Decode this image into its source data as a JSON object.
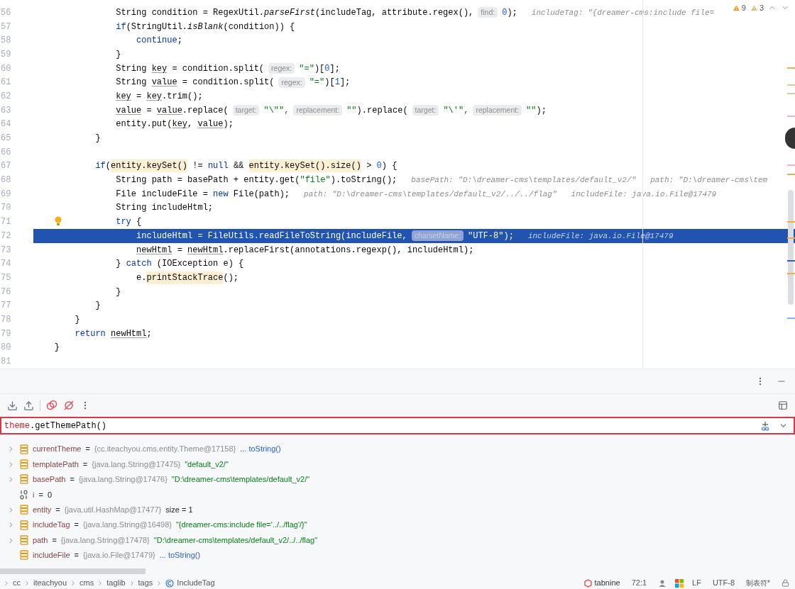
{
  "editor": {
    "inspections": [
      {
        "kind": "warning",
        "count": "9"
      },
      {
        "kind": "weak_warning",
        "count": "3"
      }
    ],
    "lines": [
      {
        "number": "56",
        "current": false,
        "bulb": false,
        "tokens": [
          {
            "kind": "plain",
            "text": "                String condition = RegexUtil."
          },
          {
            "kind": "italic",
            "text": "parseFirst"
          },
          {
            "kind": "plain",
            "text": "(includeTag, attribute.regex(),"
          },
          {
            "kind": "hint",
            "text": "find:"
          },
          {
            "kind": "number",
            "text": "0"
          },
          {
            "kind": "plain",
            "text": ");"
          },
          {
            "kind": "value",
            "text": "includeTag: \"{dreamer-cms:include file="
          }
        ]
      },
      {
        "number": "57",
        "current": false,
        "bulb": false,
        "tokens": [
          {
            "kind": "keyword",
            "text": "                if"
          },
          {
            "kind": "plain",
            "text": "(StringUtil."
          },
          {
            "kind": "italic",
            "text": "isBlank"
          },
          {
            "kind": "plain",
            "text": "(condition)) {"
          }
        ]
      },
      {
        "number": "58",
        "current": false,
        "bulb": false,
        "tokens": [
          {
            "kind": "keyword",
            "text": "                    continue"
          },
          {
            "kind": "plain",
            "text": ";"
          }
        ]
      },
      {
        "number": "59",
        "current": false,
        "bulb": false,
        "tokens": [
          {
            "kind": "plain",
            "text": "                }"
          }
        ]
      },
      {
        "number": "60",
        "current": false,
        "bulb": false,
        "tokens": [
          {
            "kind": "plain",
            "text": "                String "
          },
          {
            "kind": "var",
            "text": "key"
          },
          {
            "kind": "plain",
            "text": " = condition.split("
          },
          {
            "kind": "hint",
            "text": "regex:"
          },
          {
            "kind": "string",
            "text": "\"=\""
          },
          {
            "kind": "plain",
            "text": ")["
          },
          {
            "kind": "number",
            "text": "0"
          },
          {
            "kind": "plain",
            "text": "];"
          }
        ]
      },
      {
        "number": "61",
        "current": false,
        "bulb": false,
        "tokens": [
          {
            "kind": "plain",
            "text": "                String "
          },
          {
            "kind": "var",
            "text": "value"
          },
          {
            "kind": "plain",
            "text": " = condition.split("
          },
          {
            "kind": "hint",
            "text": "regex:"
          },
          {
            "kind": "string",
            "text": "\"=\""
          },
          {
            "kind": "plain",
            "text": ")["
          },
          {
            "kind": "number",
            "text": "1"
          },
          {
            "kind": "plain",
            "text": "];"
          }
        ]
      },
      {
        "number": "62",
        "current": false,
        "bulb": false,
        "tokens": [
          {
            "kind": "var",
            "text": "                key"
          },
          {
            "kind": "plain",
            "text": " = "
          },
          {
            "kind": "var",
            "text": "key"
          },
          {
            "kind": "plain",
            "text": ".trim();"
          }
        ]
      },
      {
        "number": "63",
        "current": false,
        "bulb": false,
        "tokens": [
          {
            "kind": "var",
            "text": "                value"
          },
          {
            "kind": "plain",
            "text": " = "
          },
          {
            "kind": "var",
            "text": "value"
          },
          {
            "kind": "plain",
            "text": ".replace("
          },
          {
            "kind": "hint",
            "text": "target:"
          },
          {
            "kind": "string",
            "text": "\"\\\"\","
          },
          {
            "kind": "hint",
            "text": "replacement:"
          },
          {
            "kind": "string",
            "text": "\"\""
          },
          {
            "kind": "plain",
            "text": ").replace("
          },
          {
            "kind": "hint",
            "text": "target:"
          },
          {
            "kind": "string",
            "text": "\"\\'\","
          },
          {
            "kind": "hint",
            "text": "replacement:"
          },
          {
            "kind": "string",
            "text": "\"\""
          },
          {
            "kind": "plain",
            "text": ");"
          }
        ]
      },
      {
        "number": "64",
        "current": false,
        "bulb": false,
        "tokens": [
          {
            "kind": "plain",
            "text": "                entity.put("
          },
          {
            "kind": "var",
            "text": "key"
          },
          {
            "kind": "plain",
            "text": ", "
          },
          {
            "kind": "var",
            "text": "value"
          },
          {
            "kind": "plain",
            "text": ");"
          }
        ]
      },
      {
        "number": "65",
        "current": false,
        "bulb": false,
        "tokens": [
          {
            "kind": "plain",
            "text": "            }"
          }
        ]
      },
      {
        "number": "66",
        "current": false,
        "bulb": false
      },
      {
        "number": "67",
        "current": false,
        "bulb": false,
        "tokens": [
          {
            "kind": "keyword",
            "text": "            if"
          },
          {
            "kind": "plain",
            "text": "("
          },
          {
            "kind": "usage",
            "text": "entity.keySet()"
          },
          {
            "kind": "plain",
            "text": " != "
          },
          {
            "kind": "keyword",
            "text": "null"
          },
          {
            "kind": "plain",
            "text": " && "
          },
          {
            "kind": "usage",
            "text": "entity.keySet().size()"
          },
          {
            "kind": "plain",
            "text": " > "
          },
          {
            "kind": "number",
            "text": "0"
          },
          {
            "kind": "plain",
            "text": ") {"
          }
        ]
      },
      {
        "number": "68",
        "current": false,
        "bulb": false,
        "tokens": [
          {
            "kind": "plain",
            "text": "                String path = basePath + entity.get("
          },
          {
            "kind": "string",
            "text": "\"file\""
          },
          {
            "kind": "plain",
            "text": ").toString();"
          },
          {
            "kind": "value",
            "text": "basePath: \"D:\\dreamer-cms\\templates/default_v2/\""
          },
          {
            "kind": "value",
            "text": "path: \"D:\\dreamer-cms\\tem"
          }
        ]
      },
      {
        "number": "69",
        "current": false,
        "bulb": false,
        "tokens": [
          {
            "kind": "plain",
            "text": "                File includeFile = "
          },
          {
            "kind": "keyword",
            "text": "new"
          },
          {
            "kind": "plain",
            "text": " File(path);"
          },
          {
            "kind": "value",
            "text": "path: \"D:\\dreamer-cms\\templates/default_v2/../../flag\""
          },
          {
            "kind": "value",
            "text": "includeFile: java.io.File@17479"
          }
        ]
      },
      {
        "number": "70",
        "current": false,
        "bulb": false,
        "tokens": [
          {
            "kind": "plain",
            "text": "                String includeHtml;"
          }
        ]
      },
      {
        "number": "71",
        "current": false,
        "bulb": true,
        "tokens": [
          {
            "kind": "keyword",
            "text": "                try"
          },
          {
            "kind": "plain",
            "text": " {"
          }
        ]
      },
      {
        "number": "72",
        "current": true,
        "bulb": false,
        "tokens": [
          {
            "kind": "plain",
            "text": "                    includeHtml = FileUtils."
          },
          {
            "kind": "italic",
            "text": "readFileToString"
          },
          {
            "kind": "plain",
            "text": "(includeFile,"
          },
          {
            "kind": "hint",
            "text": "charsetName:"
          },
          {
            "kind": "string",
            "text": "\"UTF-8\""
          },
          {
            "kind": "plain",
            "text": ");"
          },
          {
            "kind": "value",
            "text": "includeFile: java.io.File@17479"
          }
        ]
      },
      {
        "number": "73",
        "current": false,
        "bulb": false,
        "tokens": [
          {
            "kind": "var",
            "text": "                    newHtml"
          },
          {
            "kind": "plain",
            "text": " = "
          },
          {
            "kind": "var",
            "text": "newHtml"
          },
          {
            "kind": "plain",
            "text": ".replaceFirst(annotations.regexp(), includeHtml);"
          }
        ]
      },
      {
        "number": "74",
        "current": false,
        "bulb": false,
        "tokens": [
          {
            "kind": "plain",
            "text": "                } "
          },
          {
            "kind": "keyword",
            "text": "catch"
          },
          {
            "kind": "plain",
            "text": " (IOException e) {"
          }
        ]
      },
      {
        "number": "75",
        "current": false,
        "bulb": false,
        "tokens": [
          {
            "kind": "plain",
            "text": "                    e."
          },
          {
            "kind": "usage",
            "text": "printStackTrace"
          },
          {
            "kind": "plain",
            "text": "();"
          }
        ]
      },
      {
        "number": "76",
        "current": false,
        "bulb": false,
        "tokens": [
          {
            "kind": "plain",
            "text": "                }"
          }
        ]
      },
      {
        "number": "77",
        "current": false,
        "bulb": false,
        "tokens": [
          {
            "kind": "plain",
            "text": "            }"
          }
        ]
      },
      {
        "number": "78",
        "current": false,
        "bulb": false,
        "tokens": [
          {
            "kind": "plain",
            "text": "        }"
          }
        ]
      },
      {
        "number": "79",
        "current": false,
        "bulb": false,
        "tokens": [
          {
            "kind": "keyword",
            "text": "        return "
          },
          {
            "kind": "var",
            "text": "newHtml"
          },
          {
            "kind": "plain",
            "text": ";"
          }
        ]
      },
      {
        "number": "80",
        "current": false,
        "bulb": false,
        "tokens": [
          {
            "kind": "plain",
            "text": "    }"
          }
        ]
      },
      {
        "number": "81",
        "current": false,
        "bulb": false
      }
    ]
  },
  "debugger": {
    "expression": [
      {
        "kind": "var",
        "text": "theme"
      },
      {
        "kind": "plain",
        "text": ".getThemePath()"
      }
    ],
    "variables": [
      {
        "kind": "object",
        "expandable": true,
        "name": "currentTheme",
        "operator": "=",
        "type": "{cc.iteachyou.cms.entity.Theme@17158}",
        "link_value": "... toString()"
      },
      {
        "kind": "object",
        "expandable": true,
        "name": "templatePath",
        "operator": "=",
        "type": "{java.lang.String@17475}",
        "string_value": "\"default_v2/\""
      },
      {
        "kind": "object",
        "expandable": true,
        "name": "basePath",
        "operator": "=",
        "type": "{java.lang.String@17476}",
        "string_value": "\"D:\\dreamer-cms\\templates/default_v2/\""
      },
      {
        "kind": "primitive",
        "expandable": false,
        "name": "i",
        "operator": "=",
        "plain_value": "0"
      },
      {
        "kind": "object",
        "expandable": true,
        "name": "entity",
        "operator": "=",
        "type": "{java.util.HashMap@17477}",
        "plain_value": "size = 1"
      },
      {
        "kind": "object",
        "expandable": true,
        "name": "includeTag",
        "operator": "=",
        "type": "{java.lang.String@16498}",
        "string_value": "\"{dreamer-cms:include file='../../flag'/}\""
      },
      {
        "kind": "object",
        "expandable": true,
        "name": "path",
        "operator": "=",
        "type": "{java.lang.String@17478}",
        "string_value": "\"D:\\dreamer-cms\\templates/default_v2/../../flag\""
      },
      {
        "kind": "object",
        "expandable": false,
        "name": "includeFile",
        "operator": "=",
        "type": "{java.io.File@17479}",
        "link_value": "... toString()"
      }
    ]
  },
  "status_bar": {
    "breadcrumbs": [
      {
        "kind": "package",
        "label": "cc"
      },
      {
        "kind": "package",
        "label": "iteachyou"
      },
      {
        "kind": "package",
        "label": "cms"
      },
      {
        "kind": "package",
        "label": "taglib"
      },
      {
        "kind": "package",
        "label": "tags"
      },
      {
        "kind": "class",
        "label": "IncludeTag"
      }
    ],
    "plugin": "tabnine",
    "position": "72:1",
    "line_separator": "LF",
    "encoding": "UTF-8",
    "indent": "制表符*"
  }
}
